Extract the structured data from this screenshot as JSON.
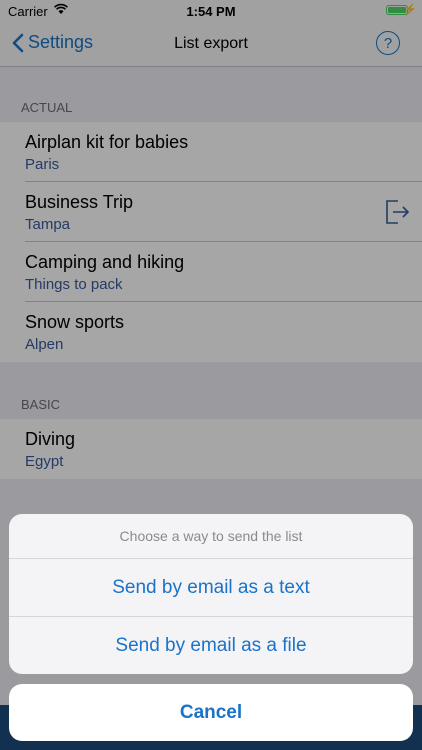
{
  "status_bar": {
    "carrier": "Carrier",
    "time": "1:54 PM"
  },
  "nav": {
    "back_label": "Settings",
    "title": "List export",
    "help_label": "?"
  },
  "sections": [
    {
      "header": "ACTUAL",
      "items": [
        {
          "title": "Airplan kit for babies",
          "subtitle": "Paris"
        },
        {
          "title": "Business Trip",
          "subtitle": "Tampa"
        },
        {
          "title": "Camping and hiking",
          "subtitle": "Things to pack"
        },
        {
          "title": "Snow sports",
          "subtitle": "Alpen"
        }
      ]
    },
    {
      "header": "BASIC",
      "items": [
        {
          "title": "Diving",
          "subtitle": "Egypt"
        }
      ]
    }
  ],
  "action_sheet": {
    "title": "Choose a way to send the list",
    "actions": [
      "Send by email as a text",
      "Send by email as a file"
    ],
    "cancel": "Cancel"
  },
  "icons": {
    "back": "chevron-left-icon",
    "help": "question-circle-icon",
    "export": "export-icon",
    "wifi": "wifi-icon",
    "battery": "battery-icon"
  },
  "colors": {
    "accent": "#1a73c8",
    "battery": "#4cd964"
  }
}
